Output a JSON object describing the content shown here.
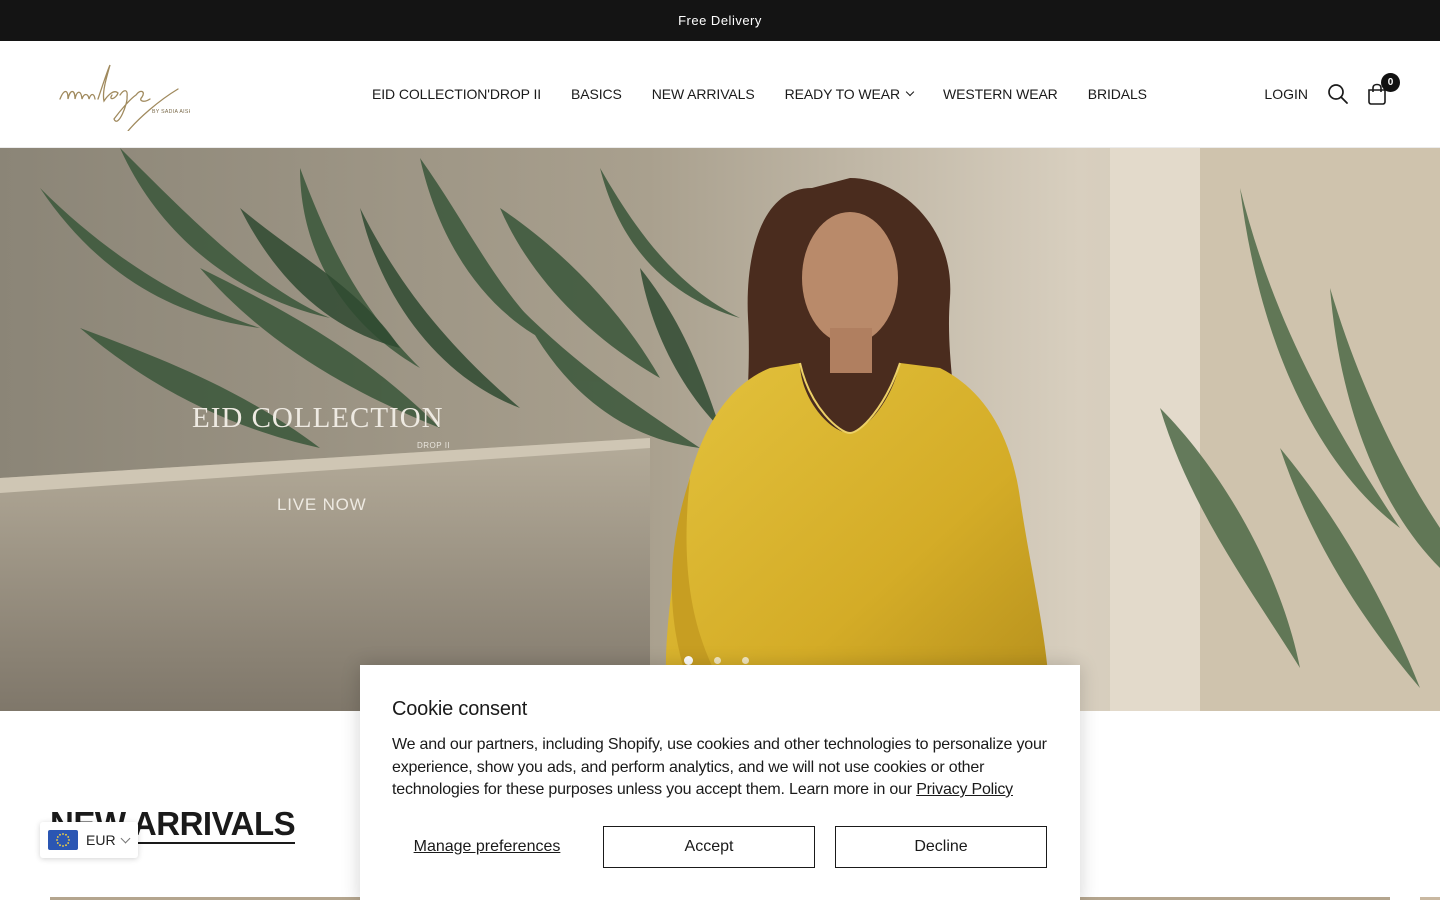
{
  "announcement": {
    "text": "Free Delivery"
  },
  "brand": {
    "logo_script": "mulaye",
    "logo_sub": "BY SADIA AISH"
  },
  "nav": {
    "items": [
      {
        "label": "EID COLLECTION'DROP II",
        "has_dropdown": false
      },
      {
        "label": "BASICS",
        "has_dropdown": false
      },
      {
        "label": "NEW ARRIVALS",
        "has_dropdown": false
      },
      {
        "label": "READY TO WEAR",
        "has_dropdown": true
      },
      {
        "label": "WESTERN WEAR",
        "has_dropdown": false
      },
      {
        "label": "BRIDALS",
        "has_dropdown": false
      }
    ]
  },
  "header_actions": {
    "login_label": "LOGIN",
    "search_icon": "search-icon",
    "cart_icon": "shopping-bag-icon",
    "cart_count": "0"
  },
  "hero": {
    "title": "EID COLLECTION",
    "subtitle": "DROP II",
    "cta": "LIVE NOW",
    "slide_count": 3,
    "active_slide": 1
  },
  "section": {
    "title": "NEW ARRIVALS"
  },
  "currency": {
    "code": "EUR",
    "flag_icon": "eu-flag-icon"
  },
  "cookie": {
    "title": "Cookie consent",
    "text": "We and our partners, including Shopify, use cookies and other technologies to personalize your experience, show you ads, and perform analytics, and we will not use cookies or other technologies for these purposes unless you accept them. Learn more in our ",
    "link": "Privacy Policy",
    "manage_label": "Manage preferences",
    "accept_label": "Accept",
    "decline_label": "Decline"
  },
  "colors": {
    "announcement_bg": "#141414",
    "dress": "#d8b22c",
    "text": "#1a1a1a"
  }
}
